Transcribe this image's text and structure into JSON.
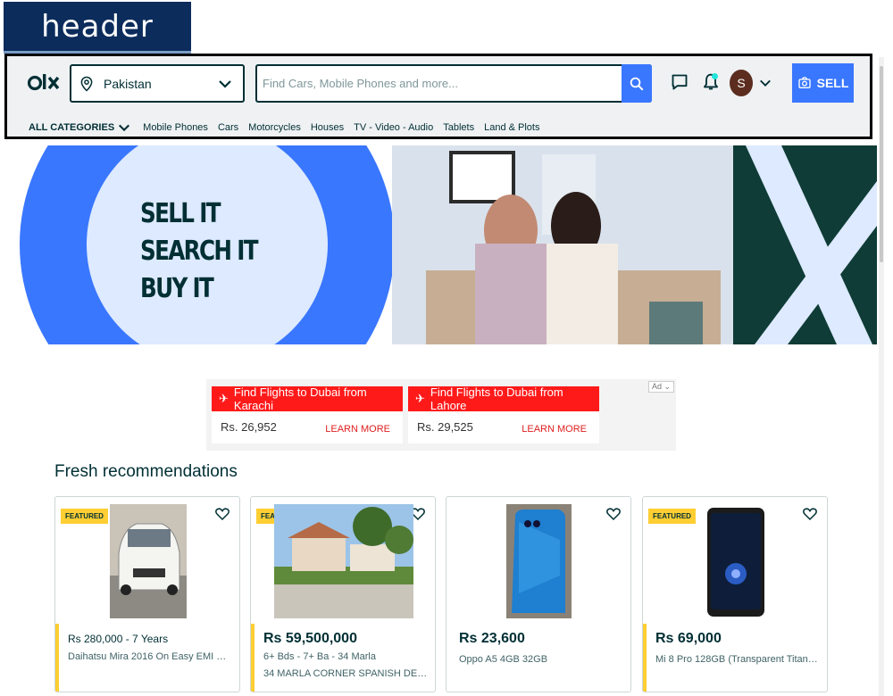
{
  "annotation": {
    "label": "header"
  },
  "header": {
    "location": {
      "value": "Pakistan"
    },
    "search": {
      "placeholder": "Find Cars, Mobile Phones and more..."
    },
    "avatar_letter": "S",
    "sell_label": "SELL",
    "icons": [
      "olx-logo",
      "location-pin-icon",
      "chevron-down-icon",
      "search-icon",
      "chat-icon",
      "bell-icon",
      "camera-icon"
    ]
  },
  "categories": {
    "all_label": "ALL CATEGORIES",
    "items": [
      "Mobile Phones",
      "Cars",
      "Motorcycles",
      "Houses",
      "TV - Video - Audio",
      "Tablets",
      "Land & Plots"
    ]
  },
  "banner": {
    "lines": [
      "SELL IT",
      "SEARCH IT",
      "BUY IT"
    ],
    "colors": {
      "blue": "#3a77ff",
      "dark": "#0f3c36",
      "light": "#ddeaff"
    }
  },
  "ads": {
    "chip": "Ad",
    "items": [
      {
        "title": "Find Flights to Dubai from Karachi",
        "price": "Rs. 26,952",
        "cta": "LEARN MORE"
      },
      {
        "title": "Find Flights to Dubai from Lahore",
        "price": "Rs. 29,525",
        "cta": "LEARN MORE"
      }
    ]
  },
  "fresh": {
    "title": "Fresh recommendations",
    "badge": "FEATURED",
    "items": [
      {
        "price": "Rs 280,000 - 7 Years",
        "title": "Daihatsu Mira 2016 On Easy EMI Pro...",
        "featured": true
      },
      {
        "price": "Rs 59,500,000",
        "sub": "6+ Bds - 7+ Ba - 34 Marla",
        "title": "34 MARLA CORNER SPANISH DESIG...",
        "featured": true
      },
      {
        "price": "Rs 23,600",
        "title": "Oppo A5 4GB 32GB",
        "featured": false
      },
      {
        "price": "Rs 69,000",
        "title": "Mi 8 Pro 128GB (Transparent Titaniu...",
        "featured": true
      }
    ]
  }
}
